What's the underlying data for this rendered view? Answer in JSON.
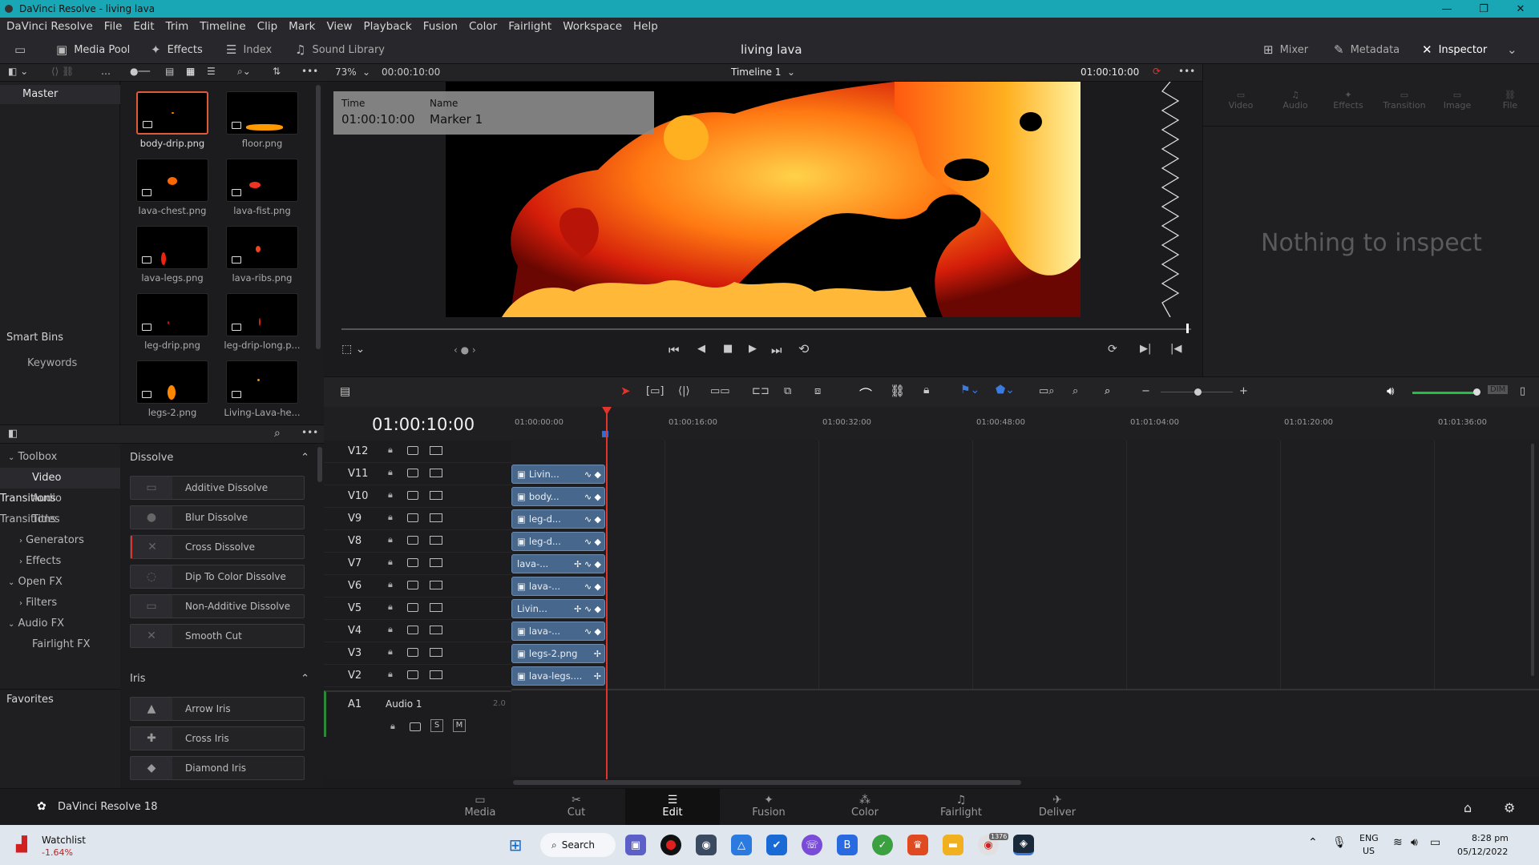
{
  "window": {
    "title": "DaVinci Resolve - living lava",
    "min": "—",
    "max": "❐",
    "close": "✕"
  },
  "menu": [
    "DaVinci Resolve",
    "File",
    "Edit",
    "Trim",
    "Timeline",
    "Clip",
    "Mark",
    "View",
    "Playback",
    "Fusion",
    "Color",
    "Fairlight",
    "Workspace",
    "Help"
  ],
  "toolbar": {
    "media_pool": "Media Pool",
    "effects": "Effects",
    "index": "Index",
    "sound_library": "Sound Library",
    "project_title": "living lava",
    "mixer": "Mixer",
    "metadata": "Metadata",
    "inspector": "Inspector"
  },
  "subtool": {
    "zoom": "73%",
    "source_tc": "00:00:10:00",
    "timeline_name": "Timeline 1",
    "record_tc": "01:00:10:00"
  },
  "bins": {
    "master": "Master",
    "smart_bins": "Smart Bins",
    "keywords": "Keywords"
  },
  "media": [
    {
      "name": "body-drip.png",
      "selected": true
    },
    {
      "name": "floor.png"
    },
    {
      "name": "lava-chest.png"
    },
    {
      "name": "lava-fist.png"
    },
    {
      "name": "lava-legs.png"
    },
    {
      "name": "lava-ribs.png"
    },
    {
      "name": "leg-drip.png"
    },
    {
      "name": "leg-drip-long.p..."
    },
    {
      "name": "legs-2.png"
    },
    {
      "name": "Living-Lava-he..."
    }
  ],
  "fx_tree": {
    "toolbox": "Toolbox",
    "video_transitions": "Video Transitions",
    "audio_transitions": "Audio Transitions",
    "titles": "Titles",
    "generators": "Generators",
    "effects": "Effects",
    "open_fx": "Open FX",
    "filters": "Filters",
    "audio_fx": "Audio FX",
    "fairlight_fx": "Fairlight FX",
    "favorites": "Favorites"
  },
  "fx_sections": {
    "dissolve": "Dissolve",
    "iris": "Iris"
  },
  "dissolves": [
    "Additive Dissolve",
    "Blur Dissolve",
    "Cross Dissolve",
    "Dip To Color Dissolve",
    "Non-Additive Dissolve",
    "Smooth Cut"
  ],
  "irises": [
    "Arrow Iris",
    "Cross Iris",
    "Diamond Iris"
  ],
  "marker": {
    "time_label": "Time",
    "time_value": "01:00:10:00",
    "name_label": "Name",
    "name_value": "Marker 1"
  },
  "inspector": {
    "tabs": [
      "Video",
      "Audio",
      "Effects",
      "Transition",
      "Image",
      "File"
    ],
    "empty": "Nothing to inspect"
  },
  "timeline": {
    "timecode": "01:00:10:00",
    "ruler": [
      "01:00:00:00",
      "01:00:16:00",
      "01:00:32:00",
      "01:00:48:00",
      "01:01:04:00",
      "01:01:20:00",
      "01:01:36:00"
    ],
    "tracks": [
      "V12",
      "V11",
      "V10",
      "V9",
      "V8",
      "V7",
      "V6",
      "V5",
      "V4",
      "V3",
      "V2"
    ],
    "clips": [
      {
        "track": "V11",
        "name": "Livin..."
      },
      {
        "track": "V10",
        "name": "body..."
      },
      {
        "track": "V9",
        "name": "leg-d..."
      },
      {
        "track": "V8",
        "name": "leg-d..."
      },
      {
        "track": "V7",
        "name": "lava-..."
      },
      {
        "track": "V6",
        "name": "lava-..."
      },
      {
        "track": "V5",
        "name": "Livin..."
      },
      {
        "track": "V4",
        "name": "lava-..."
      },
      {
        "track": "V3",
        "name": "legs-2.png"
      },
      {
        "track": "V2",
        "name": "lava-legs...."
      }
    ],
    "audio_track": "A1",
    "audio_name": "Audio 1",
    "audio_level": "2.0",
    "solo": "S",
    "mute": "M"
  },
  "pages": {
    "brand": "DaVinci Resolve 18",
    "items": [
      "Media",
      "Cut",
      "Edit",
      "Fusion",
      "Color",
      "Fairlight",
      "Deliver"
    ],
    "active": "Edit"
  },
  "taskbar": {
    "watchlist": "Watchlist",
    "watch_change": "-1.64%",
    "search": "Search",
    "lang1": "ENG",
    "lang2": "US",
    "time": "8:28 pm",
    "date": "05/12/2022",
    "badge": "1376"
  },
  "colors": {
    "accent": "#e05a3a",
    "clip": "#47688c",
    "playhead": "#e0352a",
    "title_bar": "#1aa7b5"
  }
}
